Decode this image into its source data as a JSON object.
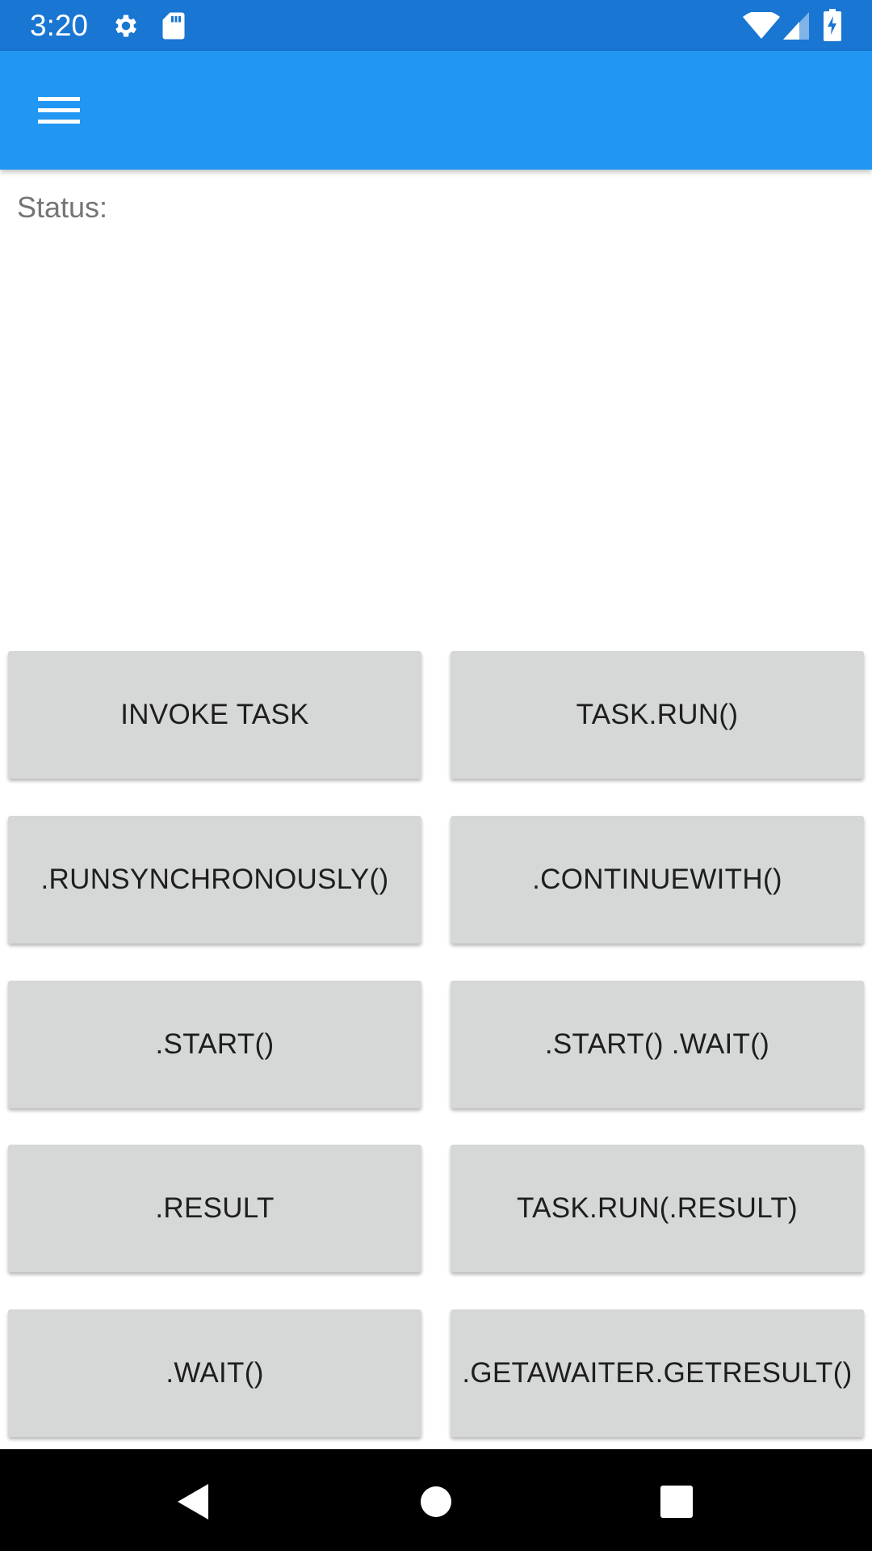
{
  "status_bar": {
    "time": "3:20",
    "icons": [
      "gear-icon",
      "sd-card-icon",
      "wifi-icon",
      "signal-icon",
      "battery-charging-icon"
    ]
  },
  "app_bar": {
    "menu_icon": "hamburger-menu-icon",
    "color": "#2196f3"
  },
  "main": {
    "status_label": "Status:"
  },
  "buttons": [
    {
      "label": "INVOKE TASK"
    },
    {
      "label": "TASK.RUN()"
    },
    {
      "label": ".RUNSYNCHRONOUSLY()"
    },
    {
      "label": ".CONTINUEWITH()"
    },
    {
      "label": ".START()"
    },
    {
      "label": ".START() .WAIT()"
    },
    {
      "label": ".RESULT"
    },
    {
      "label": "TASK.RUN(.RESULT)"
    },
    {
      "label": ".WAIT()"
    },
    {
      "label": ".GETAWAITER.GETRESULT()"
    }
  ],
  "nav_bar": {
    "icons": [
      "back-icon",
      "home-icon",
      "recents-icon"
    ]
  },
  "colors": {
    "status_bar": "#1976d2",
    "app_bar": "#2196f3",
    "button_bg": "#d6d7d7",
    "status_text": "#757575"
  }
}
